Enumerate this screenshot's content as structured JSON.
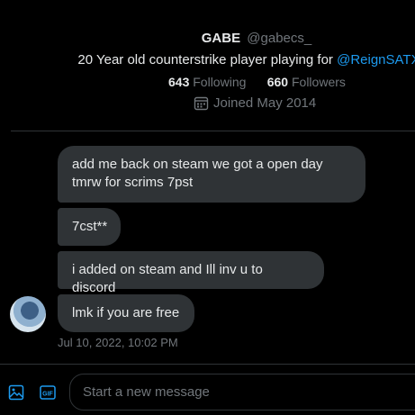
{
  "profile": {
    "name": "GABE",
    "handle": "@gabecs_",
    "bio_text": "20 Year old counterstrike player playing for ",
    "bio_mention": "@ReignSATX",
    "following_count": "643",
    "following_label": "Following",
    "followers_count": "660",
    "followers_label": "Followers",
    "joined": "Joined May 2014"
  },
  "messages": [
    {
      "text": "add me back on steam we got a open day tmrw for scrims 7pst"
    },
    {
      "text": "7cst**"
    },
    {
      "text": "i added on steam and Ill inv u to discord"
    },
    {
      "text": "lmk if you are free"
    }
  ],
  "timestamp": "Jul 10, 2022, 10:02 PM",
  "composer": {
    "placeholder": "Start a new message",
    "gif_label": "GIF"
  },
  "colors": {
    "accent": "#1d9bf0",
    "bubble": "#2f3336",
    "background": "#000000"
  }
}
